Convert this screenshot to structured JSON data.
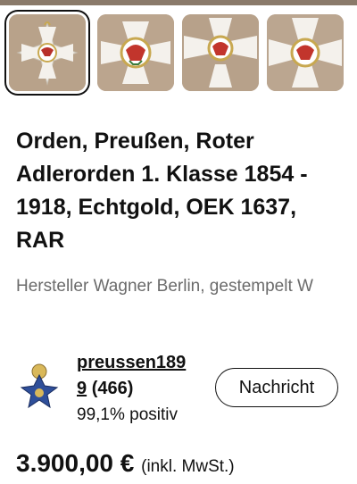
{
  "gallery": {
    "thumbnails": [
      {
        "name": "order-cross-front-1",
        "selected": true
      },
      {
        "name": "order-cross-front-2",
        "selected": false
      },
      {
        "name": "order-cross-front-3",
        "selected": false
      },
      {
        "name": "order-cross-front-4",
        "selected": false
      }
    ]
  },
  "listing": {
    "title": "Orden, Preußen, Roter Adlerorden 1. Klasse 1854 - 1918, Echtgold, OEK 1637, RAR",
    "subtitle": "Hersteller Wagner Berlin, gestempelt W"
  },
  "seller": {
    "name_line1": "preussen189",
    "name_line2": "9",
    "rating_count": "(466)",
    "feedback": "99,1% positiv",
    "message_button": "Nachricht"
  },
  "price": {
    "amount": "3.900,00 €",
    "note": "(inkl. MwSt.)"
  },
  "colors": {
    "text": "#111111",
    "muted": "#6b6b6b",
    "background": "#ffffff"
  }
}
